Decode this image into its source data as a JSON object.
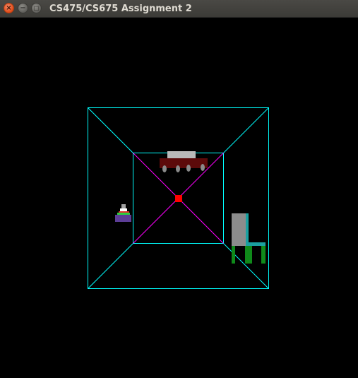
{
  "window": {
    "title": "CS475/CS675 Assignment 2",
    "buttons": {
      "close_glyph": "×",
      "minimize_glyph": "−",
      "maximize_glyph": "□"
    }
  },
  "scene": {
    "background": "#000000",
    "colors": {
      "outer_frame": "#00ffff",
      "inner_frame": "#00ffff",
      "corner_lines": "#00ffff",
      "inner_diagonals": "#ff00ff",
      "center_point": "#ff0000",
      "car_body": "#5c0a0a",
      "car_roof": "#b9b9b9",
      "car_wheels": "#8a8a8a",
      "chair_back": "#8c8c8c",
      "chair_frame": "#1aa0a0",
      "chair_legs": "#0f8a1a",
      "stack_base": "#5c3d96",
      "stack_green": "#2ecc40",
      "stack_red": "#e03030",
      "stack_white": "#ffffff",
      "stack_gray": "#a0a0a0"
    }
  }
}
